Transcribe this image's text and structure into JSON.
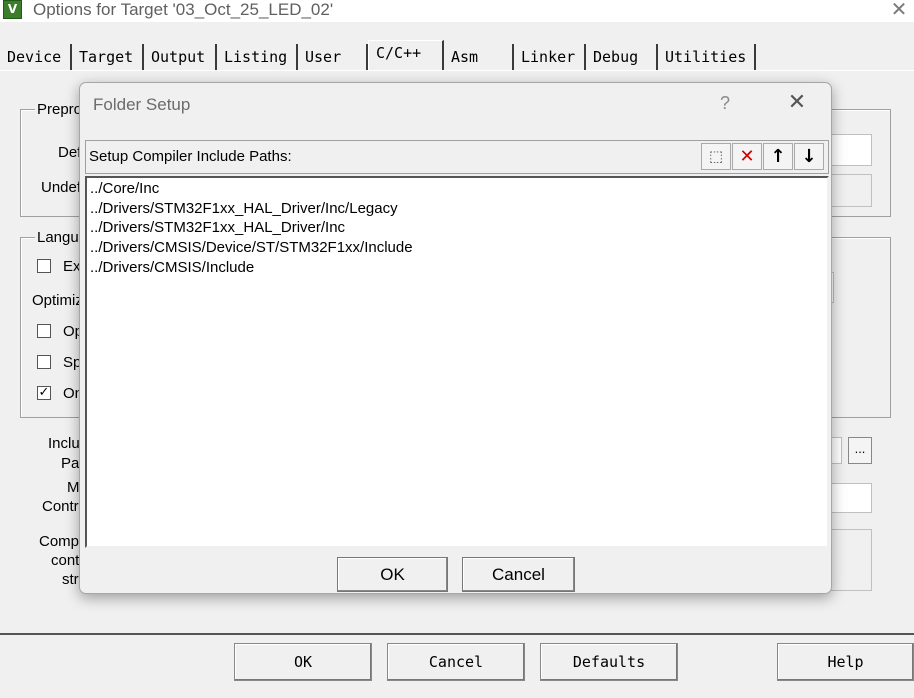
{
  "window": {
    "icon_label": "V",
    "title": "Options for Target '03_Oct_25_LED_02'",
    "close_glyph": "✕"
  },
  "tabs": [
    {
      "label": "Device",
      "active": false
    },
    {
      "label": "Target",
      "active": false
    },
    {
      "label": "Output",
      "active": false
    },
    {
      "label": "Listing",
      "active": false
    },
    {
      "label": "User",
      "active": false
    },
    {
      "label": "C/C++",
      "active": true
    },
    {
      "label": "Asm",
      "active": false
    },
    {
      "label": "Linker",
      "active": false
    },
    {
      "label": "Debug",
      "active": false
    },
    {
      "label": "Utilities",
      "active": false
    }
  ],
  "background_panel": {
    "preproc_group_label": "Prepro",
    "define_label": "Def",
    "undefine_label": "Undef",
    "language_group_label": "Langu",
    "ex_label": "Ex",
    "optimize_label": "Optimiz",
    "op_label": "Op",
    "sp_label": "Sp",
    "on_label": "On",
    "include_paths_label_1": "Inclu",
    "include_paths_label_2": "Pat",
    "misc_label_1": "M",
    "misc_label_2": "Contr",
    "compiler_label_1": "Comp",
    "compiler_label_2": "cont",
    "compiler_label_3": "stri",
    "browse_label": "...",
    "ex_checked": false,
    "op_checked": false,
    "sp_checked": false,
    "on_checked": true,
    "check_glyph": "✓"
  },
  "footer": {
    "ok": "OK",
    "cancel": "Cancel",
    "defaults": "Defaults",
    "help": "Help"
  },
  "dialog": {
    "title": "Folder Setup",
    "help_glyph": "?",
    "close_glyph": "✕",
    "caption": "Setup Compiler Include Paths:",
    "tools": {
      "new_glyph": "⬚",
      "delete_glyph": "✕",
      "up_glyph": "↑",
      "down_glyph": "↓"
    },
    "paths": [
      "../Core/Inc",
      "../Drivers/STM32F1xx_HAL_Driver/Inc/Legacy",
      "../Drivers/STM32F1xx_HAL_Driver/Inc",
      "../Drivers/CMSIS/Device/ST/STM32F1xx/Include",
      "../Drivers/CMSIS/Include"
    ],
    "ok": "OK",
    "cancel": "Cancel"
  }
}
